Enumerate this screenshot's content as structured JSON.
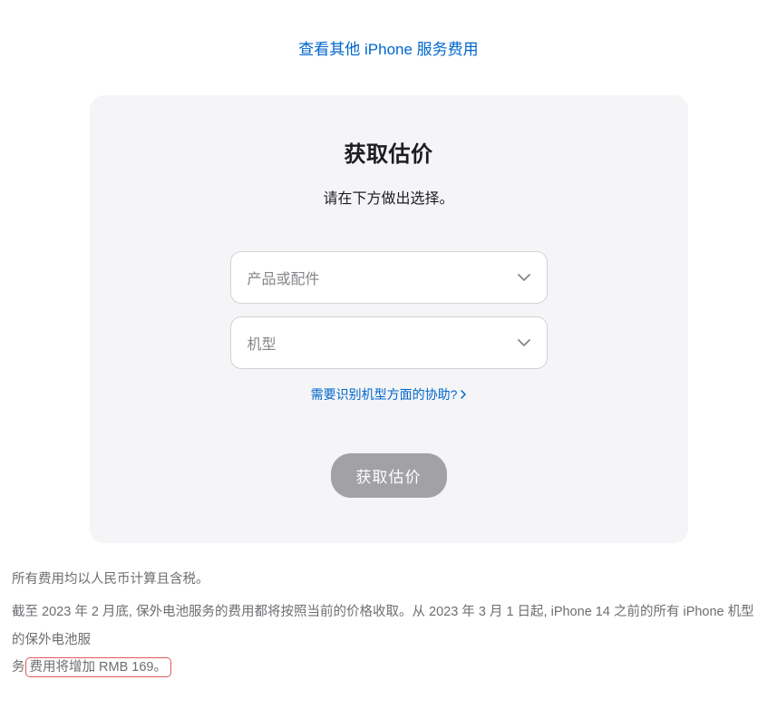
{
  "topLink": "查看其他 iPhone 服务费用",
  "card": {
    "title": "获取估价",
    "subtitle": "请在下方做出选择。",
    "select1_placeholder": "产品或配件",
    "select2_placeholder": "机型",
    "helpLink": "需要识别机型方面的协助?",
    "submitLabel": "获取估价"
  },
  "footer": {
    "line1": "所有费用均以人民币计算且含税。",
    "line2a": "截至 2023 年 2 月底, 保外电池服务的费用都将按照当前的价格收取。从 2023 年 3 月 1 日起, iPhone 14 之前的所有 iPhone 机型的保外电池服",
    "line2b": "务",
    "highlighted": "费用将增加 RMB 169。"
  }
}
